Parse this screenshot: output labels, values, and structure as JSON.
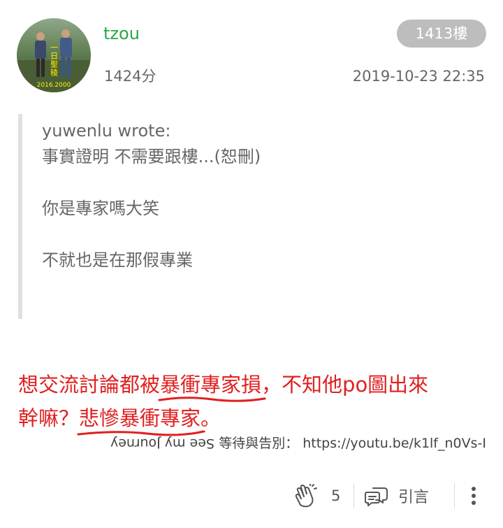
{
  "post": {
    "username": "tzou",
    "score": "1424分",
    "floor": "1413樓",
    "timestamp": "2019-10-23 22:35",
    "avatar": {
      "caption_top": "一日聖稜",
      "caption_bottom": "2016.2000"
    }
  },
  "quote": {
    "author_line": "yuwenlu wrote:",
    "lines": [
      "事實證明 不需要跟樓...(恕刪)",
      "",
      "你是專家嗎大笑",
      "",
      "不就也是在那假專業"
    ]
  },
  "body": {
    "seg1": "想交流討論都被",
    "seg2_highlight": "暴衝專家損",
    "seg3": "，不知他po圖出來",
    "seg4": "幹嘛？",
    "seg5_highlight": "悲慘暴衝專家",
    "seg6": "。"
  },
  "signature": {
    "flipped_text": "See my Journey",
    "text": "等待與告別：  https://youtu.be/k1lf_n0Vs-I"
  },
  "actions": {
    "like_count": "5",
    "quote_label": "引言"
  },
  "colors": {
    "username": "#28a745",
    "highlight": "#e02020",
    "badge_bg": "#bdbdbd"
  },
  "icons": [
    "clap-icon",
    "quote-bubble-icon",
    "more-vertical-icon"
  ]
}
